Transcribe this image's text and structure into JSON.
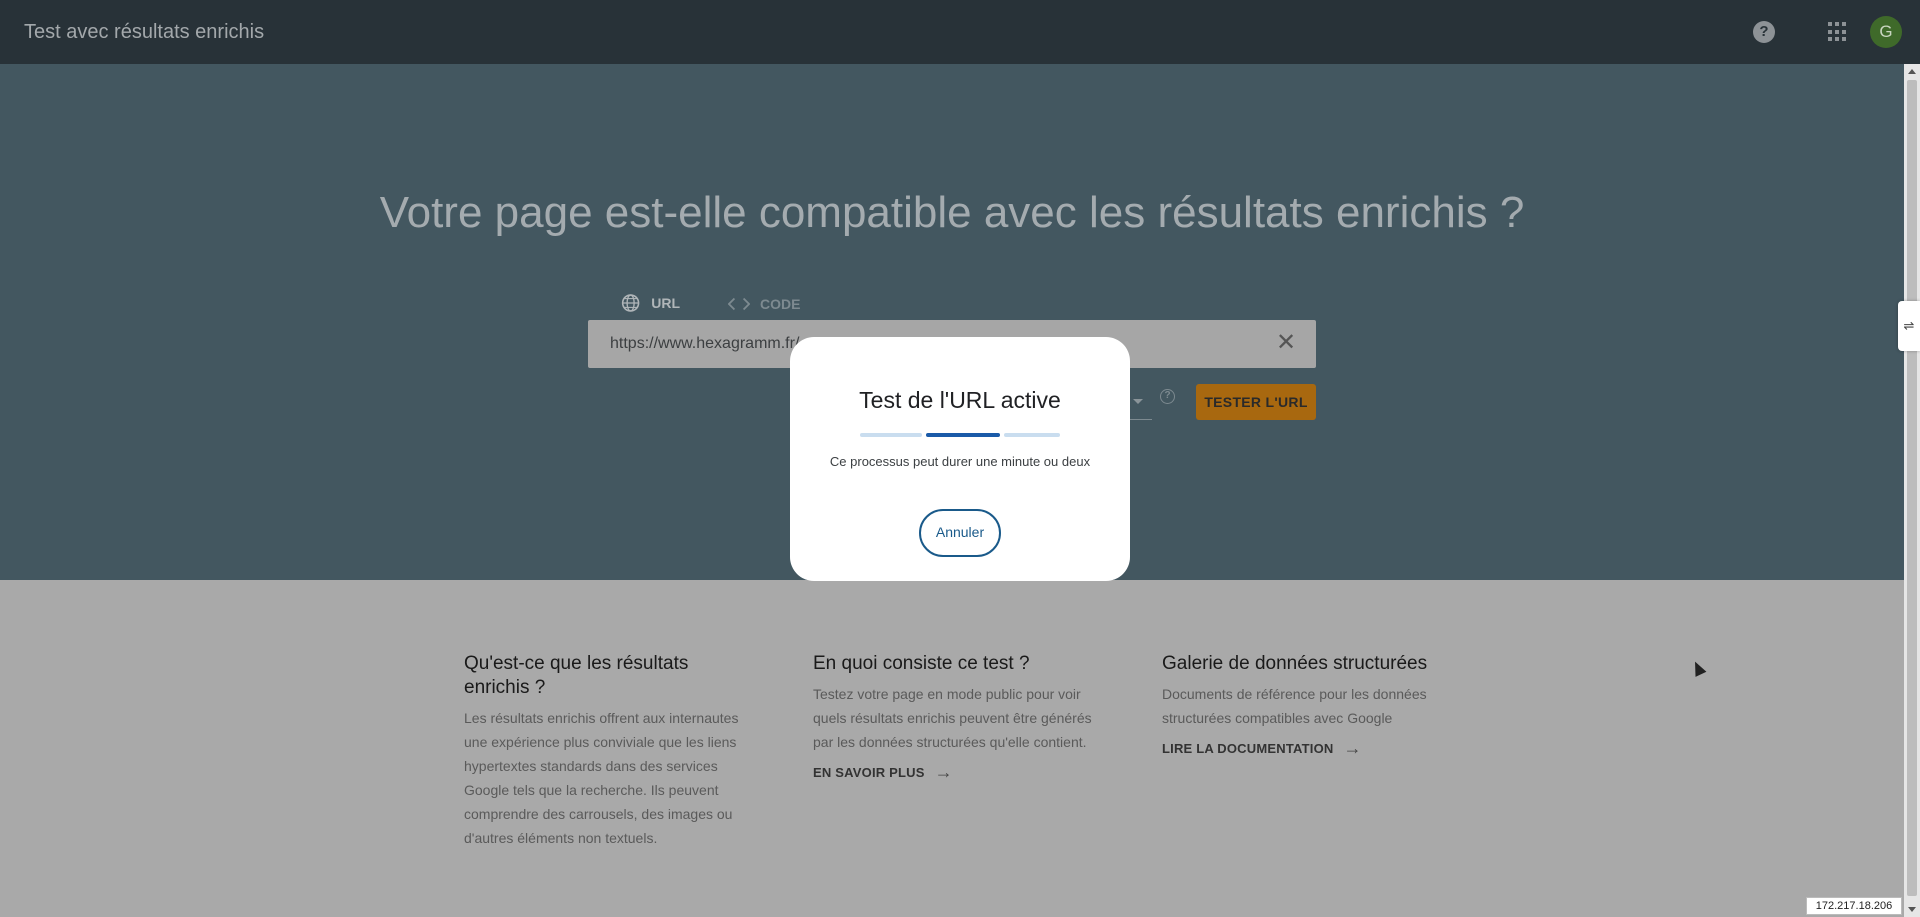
{
  "appbar": {
    "title": "Test avec résultats enrichis",
    "help_icon": "help-circle-icon",
    "apps_icon": "apps-grid-icon",
    "avatar_letter": "G",
    "avatar_color": "#3f6a2a"
  },
  "hero": {
    "title": "Votre page est-elle compatible avec les résultats enrichis ?",
    "tabs": [
      {
        "label": "URL",
        "icon": "globe-icon",
        "active": true
      },
      {
        "label": "CODE",
        "icon": "code-icon",
        "active": false
      }
    ],
    "url_value": "https://www.hexagramm.fr/",
    "test_button": "TESTER L'URL",
    "accent_color": "#a8680f"
  },
  "info": {
    "columns": [
      {
        "title": "Qu'est-ce que les résultats enrichis ?",
        "text": "Les résultats enrichis offrent aux internautes une expérience plus conviviale que les liens hypertextes standards dans des services Google tels que la recherche. Ils peuvent comprendre des carrousels, des images ou d'autres éléments non textuels.",
        "link": ""
      },
      {
        "title": "En quoi consiste ce test ?",
        "text": "Testez votre page en mode public pour voir quels résultats enrichis peuvent être générés par les données structurées qu'elle contient.",
        "link": "EN SAVOIR PLUS"
      },
      {
        "title": "Galerie de données structurées",
        "text": "Documents de référence pour les données structurées compatibles avec Google",
        "link": "LIRE LA DOCUMENTATION"
      }
    ]
  },
  "dialog": {
    "title": "Test de l'URL active",
    "message": "Ce processus peut durer une minute ou deux",
    "cancel_label": "Annuler",
    "progress_color": "#1a5aa8"
  },
  "status": {
    "ip": "172.217.18.206"
  }
}
